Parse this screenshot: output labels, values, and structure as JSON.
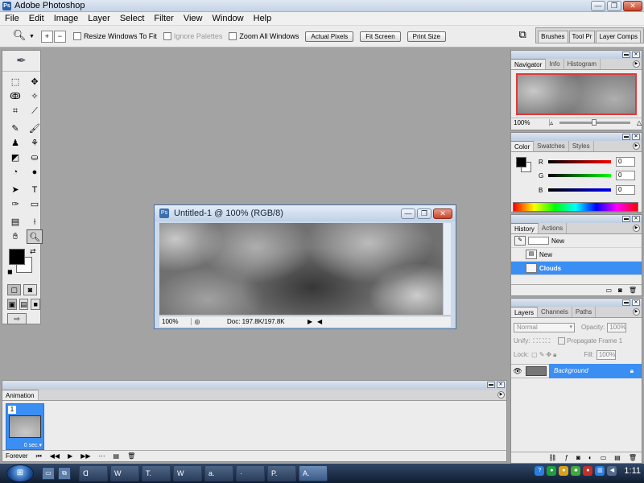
{
  "window": {
    "title": "Adobe Photoshop",
    "app_icon": "Ps",
    "minimize": "—",
    "restore": "❐",
    "close": "✕"
  },
  "menu": [
    "File",
    "Edit",
    "Image",
    "Layer",
    "Select",
    "Filter",
    "View",
    "Window",
    "Help"
  ],
  "options": {
    "resize_windows": "Resize Windows To Fit",
    "ignore_palettes": "Ignore Palettes",
    "zoom_all": "Zoom All Windows",
    "actual_pixels": "Actual Pixels",
    "fit_screen": "Fit Screen",
    "print_size": "Print Size",
    "palette_tabs": [
      "Brushes",
      "Tool Pr",
      "Layer Comps"
    ]
  },
  "document": {
    "title": "Untitled-1 @ 100% (RGB/8)",
    "zoom": "100%",
    "doc_size": "Doc: 197.8K/197.8K"
  },
  "navigator": {
    "tabs": [
      "Navigator",
      "Info",
      "Histogram"
    ],
    "zoom": "100%"
  },
  "color": {
    "tabs": [
      "Color",
      "Swatches",
      "Styles"
    ],
    "channels": [
      {
        "label": "R",
        "value": "0",
        "gradient": "linear-gradient(90deg,#000,#f00)"
      },
      {
        "label": "G",
        "value": "0",
        "gradient": "linear-gradient(90deg,#000,#0f0)"
      },
      {
        "label": "B",
        "value": "0",
        "gradient": "linear-gradient(90deg,#000,#00f)"
      }
    ]
  },
  "history": {
    "tabs": [
      "History",
      "Actions"
    ],
    "snapshot": "New",
    "steps": [
      "New",
      "Clouds"
    ]
  },
  "layers": {
    "tabs": [
      "Layers",
      "Channels",
      "Paths"
    ],
    "blend_mode": "Normal",
    "opacity_label": "Opacity:",
    "opacity": "100%",
    "unify_label": "Unify:",
    "propagate": "Propagate Frame 1",
    "lock_label": "Lock:",
    "fill_label": "Fill:",
    "fill": "100%",
    "layer_name": "Background"
  },
  "animation": {
    "tab": "Animation",
    "frame_number": "1",
    "frame_time": "0 sec.▾",
    "loop": "Forever"
  },
  "taskbar": {
    "start": "⊞",
    "buttons": [
      "ᗡ",
      "W",
      "T.",
      "W",
      "a.",
      "·",
      "P.",
      "A."
    ],
    "active": "A.",
    "clock": "1:11"
  }
}
